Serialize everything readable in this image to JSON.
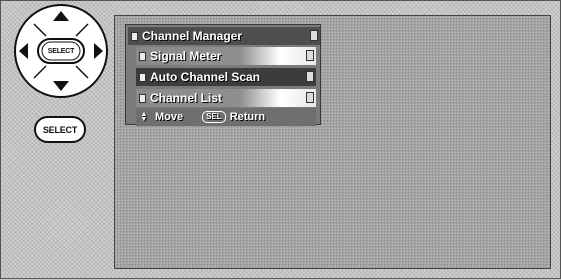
{
  "remote": {
    "dpad_center_label": "SELECT",
    "select_button_label": "SELECT"
  },
  "menu": {
    "title": "Channel Manager",
    "items": [
      {
        "label": "Signal Meter",
        "selected": false
      },
      {
        "label": "Auto Channel Scan",
        "selected": true
      },
      {
        "label": "Channel List",
        "selected": false
      }
    ],
    "footer": {
      "move_label": "Move",
      "sel_badge": "SEL",
      "return_label": "Return"
    }
  },
  "icons": [
    "arrow-up-icon",
    "arrow-down-icon",
    "arrow-left-icon",
    "arrow-right-icon",
    "updown-arrows-icon"
  ]
}
